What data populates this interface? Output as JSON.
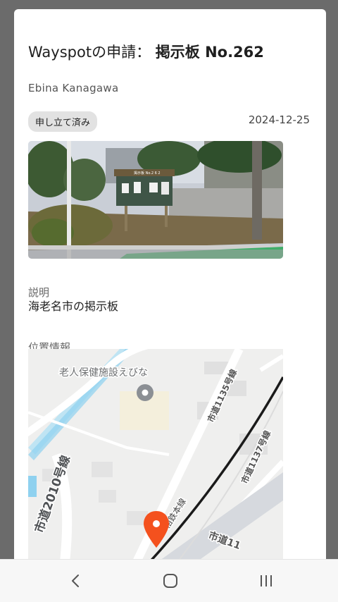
{
  "header": {
    "title_prefix": "Wayspotの申請：",
    "title_name": "掲示板 No.262"
  },
  "location": "Ebina Kanagawa",
  "status_badge": "申し立て済み",
  "date": "2024-12-25",
  "photo": {
    "sign_text": "掲示板 No.2 6 2"
  },
  "description": {
    "label": "説明",
    "value": "海老名市の掲示板"
  },
  "location_info": {
    "label": "位置情報"
  },
  "map": {
    "poi_label": "老人保健施設えびな",
    "roads": [
      "市道1135号線",
      "市道1137号線",
      "市道2010号線",
      "相鉄本線",
      "市道11"
    ]
  },
  "colors": {
    "pin": "#f4511e",
    "rail": "#1a1a1a",
    "water": "#8fd1ef"
  },
  "navbar": {
    "icons": [
      "back-icon",
      "home-icon",
      "recents-icon"
    ]
  }
}
